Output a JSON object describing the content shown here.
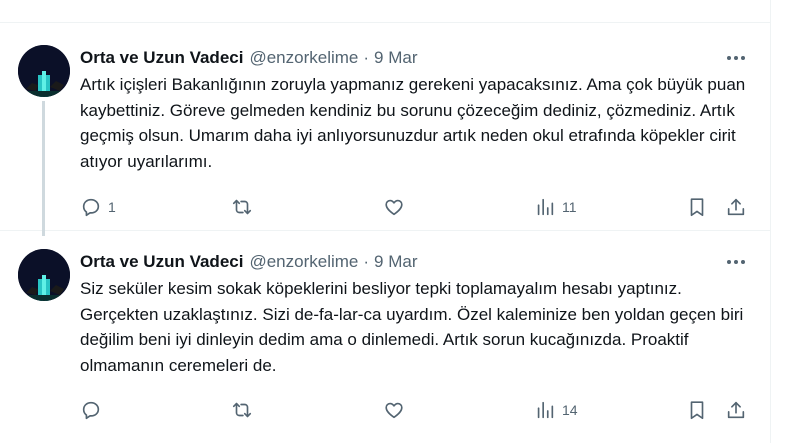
{
  "tweets": [
    {
      "author_name": "Orta ve Uzun Vadeci",
      "handle": "@enzorkelime",
      "separator": "·",
      "date": "9 Mar",
      "text": "Artık içişleri Bakanlığının zoruyla yapmanız gerekeni yapacaksınız. Ama çok büyük puan kaybettiniz. Göreve gelmeden kendiniz bu sorunu çözeceğim dediniz, çözmediniz. Artık geçmiş olsun. Umarım daha iyi anlıyorsunuzdur artık neden okul etrafında köpekler cirit atıyor uyarılarımı.",
      "reply_count": "1",
      "retweet_count": "",
      "like_count": "",
      "view_count": "11"
    },
    {
      "author_name": "Orta ve Uzun Vadeci",
      "handle": "@enzorkelime",
      "separator": "·",
      "date": "9 Mar",
      "text": "Siz seküler kesim sokak köpeklerini besliyor tepki toplamayalım hesabı yaptınız. Gerçekten uzaklaştınız. Sizi de-fa-lar-ca uyardım. Özel kaleminize ben yoldan geçen biri değilim beni iyi dinleyin dedim ama o dinlemedi. Artık sorun kucağınızda. Proaktif olmamanın ceremeleri de.",
      "reply_count": "",
      "retweet_count": "",
      "like_count": "",
      "view_count": "14"
    }
  ],
  "icons": {
    "reply": "reply-icon",
    "retweet": "retweet-icon",
    "like": "heart-icon",
    "views": "views-icon",
    "bookmark": "bookmark-icon",
    "share": "share-icon",
    "more": "more-icon"
  },
  "colors": {
    "text": "#0f1419",
    "secondary": "#536471",
    "border": "#eff3f4",
    "thread_line": "#cfd9de"
  }
}
